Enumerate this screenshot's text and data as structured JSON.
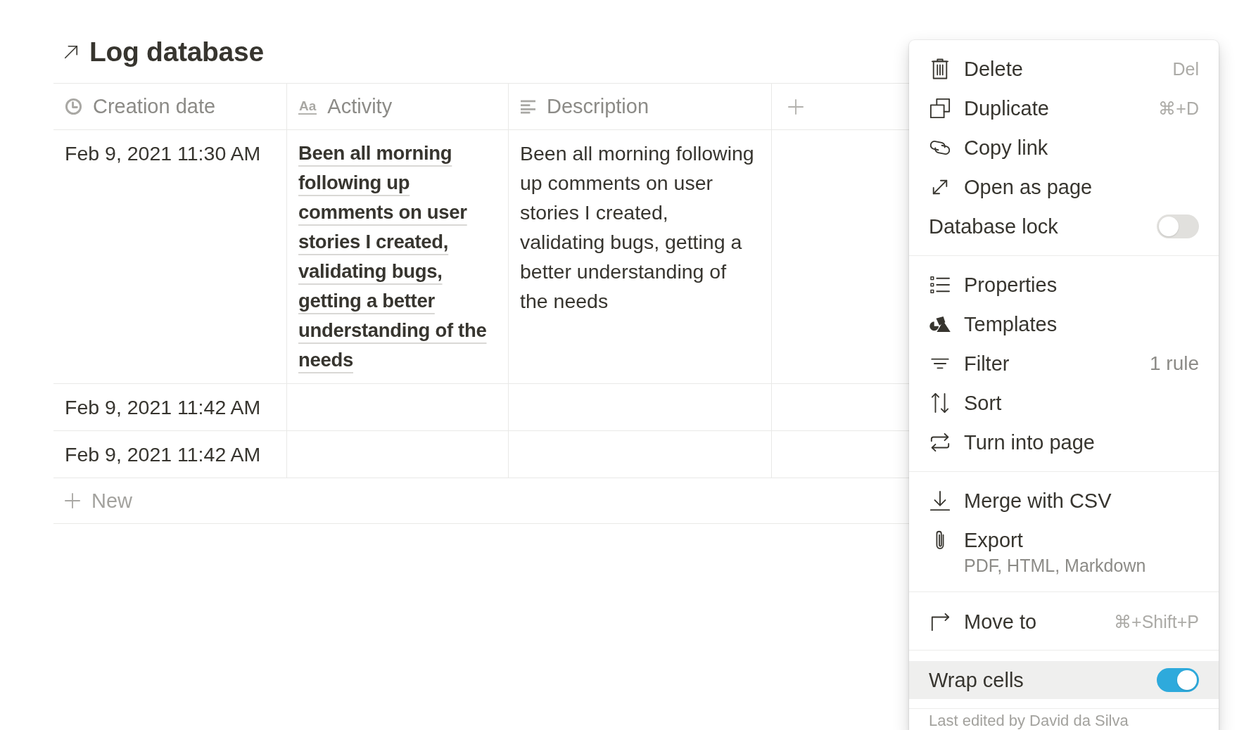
{
  "page": {
    "title": "Log database"
  },
  "table": {
    "columns": [
      {
        "kind": "date",
        "label": "Creation date"
      },
      {
        "kind": "title",
        "label": "Activity",
        "icon_glyph": "Aa"
      },
      {
        "kind": "text",
        "label": "Description"
      }
    ],
    "rows": [
      {
        "cells": [
          "Feb 9, 2021 11:30 AM",
          "Been all morning following up comments on user stories I created, validating bugs, getting a better understanding of the needs",
          "Been all morning following up comments on user stories I created, validating bugs, getting a better understanding of the needs"
        ]
      },
      {
        "cells": [
          "Feb 9, 2021 11:42 AM"
        ]
      },
      {
        "cells": [
          "Feb 9, 2021 11:42 AM"
        ]
      }
    ],
    "new_row": "New"
  },
  "menu": {
    "sections": [
      {
        "items": [
          {
            "kind": "action",
            "label": "Delete",
            "shortcut": "Del",
            "selected": false
          },
          {
            "kind": "action",
            "label": "Duplicate",
            "shortcut": "⌘+D",
            "selected": false
          },
          {
            "kind": "action",
            "label": "Copy link",
            "selected": false
          },
          {
            "kind": "action",
            "label": "Open as page",
            "selected": false
          },
          {
            "kind": "toggle",
            "label": "Database lock",
            "on": false,
            "selected": false
          }
        ]
      },
      {
        "items": [
          {
            "kind": "action",
            "label": "Properties",
            "selected": false
          },
          {
            "kind": "action",
            "label": "Templates",
            "selected": false
          },
          {
            "kind": "action",
            "label": "Filter",
            "detail": "1 rule",
            "selected": false
          },
          {
            "kind": "action",
            "label": "Sort",
            "selected": false
          },
          {
            "kind": "action",
            "label": "Turn into page",
            "selected": false
          }
        ]
      },
      {
        "items": [
          {
            "kind": "action",
            "label": "Merge with CSV",
            "selected": false
          },
          {
            "kind": "action",
            "label": "Export",
            "description": "PDF, HTML, Markdown",
            "selected": false
          }
        ]
      },
      {
        "items": [
          {
            "kind": "action",
            "label": "Move to",
            "shortcut": "⌘+Shift+P",
            "selected": false
          }
        ]
      },
      {
        "items": [
          {
            "kind": "toggle",
            "label": "Wrap cells",
            "on": true,
            "selected": true
          }
        ]
      }
    ],
    "footer": "Last edited by David da Silva"
  }
}
